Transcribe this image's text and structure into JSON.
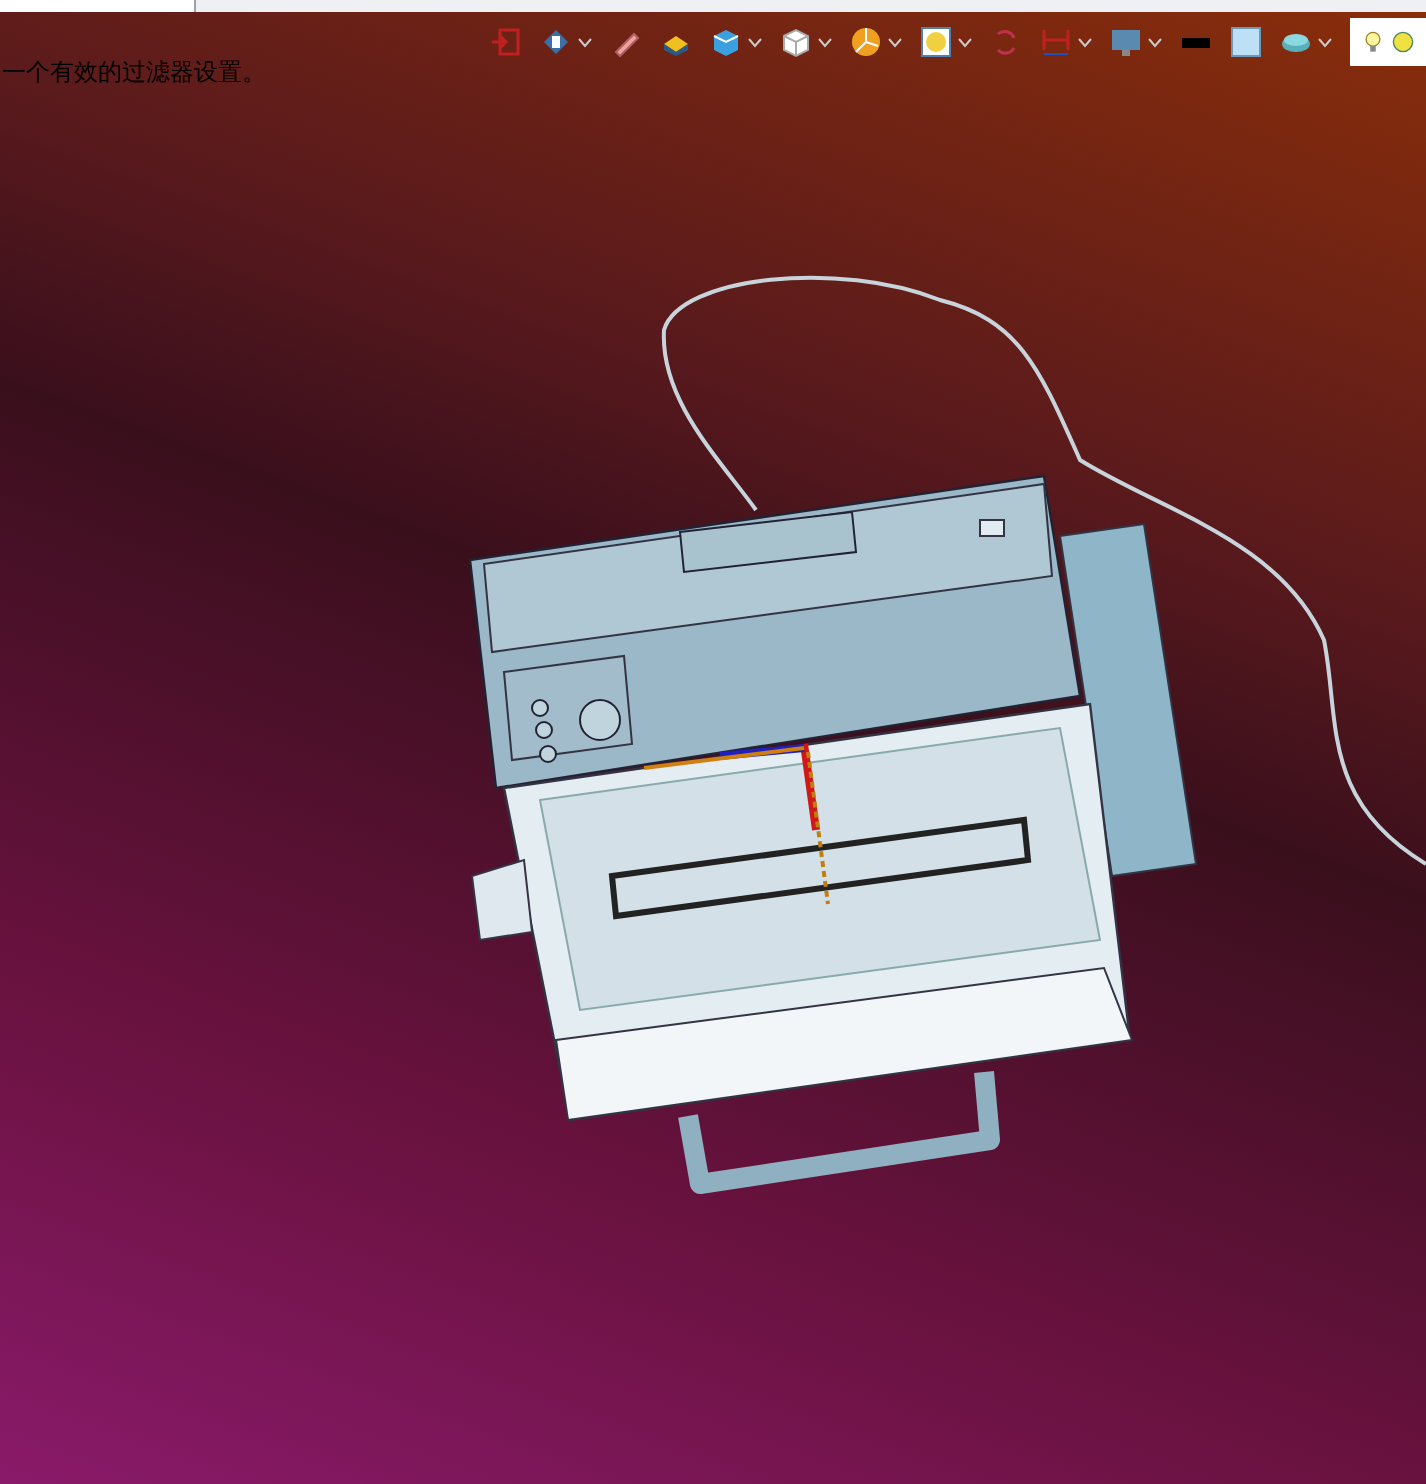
{
  "toolbar": {
    "items": [
      {
        "kind": "exit",
        "dropdown": false
      },
      {
        "kind": "view",
        "dropdown": true
      },
      {
        "kind": "pencil",
        "dropdown": false
      },
      {
        "kind": "block",
        "dropdown": false
      },
      {
        "kind": "cube",
        "dropdown": true
      },
      {
        "kind": "whitecube",
        "dropdown": true
      },
      {
        "kind": "pie",
        "dropdown": true
      },
      {
        "kind": "zoom",
        "dropdown": true
      },
      {
        "kind": "snap",
        "dropdown": false
      },
      {
        "kind": "dimension",
        "dropdown": true
      },
      {
        "kind": "monitor",
        "dropdown": true
      },
      {
        "kind": "blackbar",
        "dropdown": false
      },
      {
        "kind": "bluesquare",
        "dropdown": false
      },
      {
        "kind": "layers",
        "dropdown": true
      }
    ],
    "lights": [
      {
        "kind": "bulb"
      },
      {
        "kind": "lamp"
      }
    ]
  },
  "status_message": "一个有效的过滤器设置。"
}
